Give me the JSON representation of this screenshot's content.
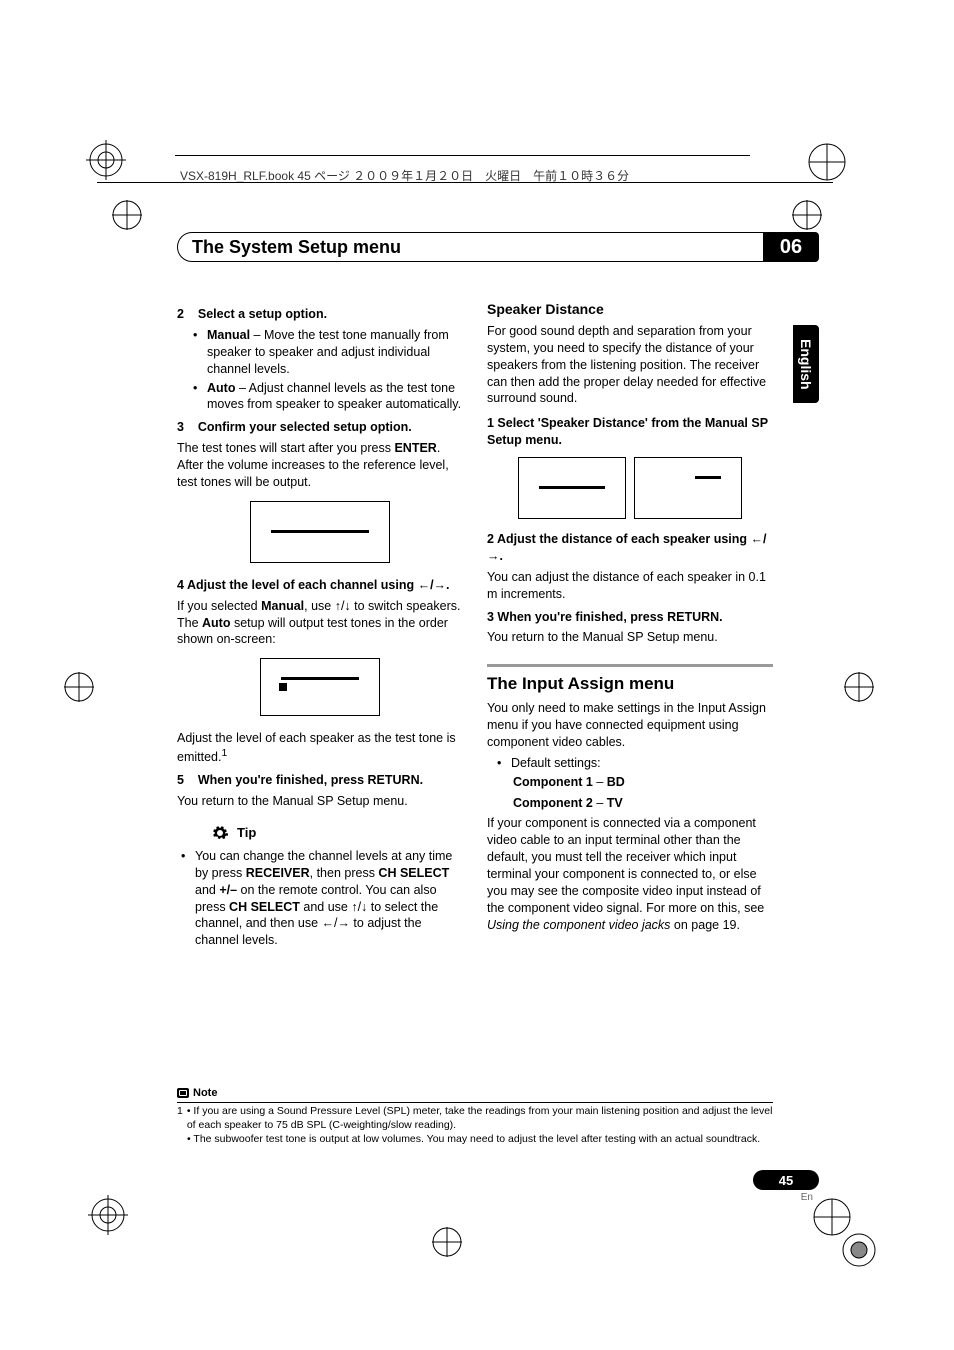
{
  "header_line": "VSX-819H_RLF.book  45 ページ  ２００９年１月２０日　火曜日　午前１０時３６分",
  "title": "The System Setup menu",
  "chapter": "06",
  "lang_tab": "English",
  "left": {
    "s2": {
      "num": "2",
      "head": "Select a setup option."
    },
    "b_manual_label": "Manual",
    "b_manual_text": " – Move the test tone manually from speaker to speaker and adjust individual channel levels.",
    "b_auto_label": "Auto",
    "b_auto_text": " – Adjust channel levels as the test tone moves from speaker to speaker automatically.",
    "s3": {
      "num": "3",
      "head": "Confirm your selected setup option."
    },
    "s3_p1a": "The test tones will start after you press ",
    "s3_p1b": "ENTER",
    "s3_p1c": ". After the volume increases to the reference level, test tones will be output.",
    "s4_head": "4    Adjust the level of each channel using ←/→.",
    "s4_p1a": "If you selected ",
    "s4_p1b": "Manual",
    "s4_p1c": ", use ↑/↓ to switch speakers. The ",
    "s4_p1d": "Auto",
    "s4_p1e": " setup will output test tones in the order shown on-screen:",
    "s4_p2": "Adjust the level of each speaker as the test tone is emitted.",
    "sup1": "1",
    "s5": {
      "num": "5",
      "head": "When you're finished, press RETURN."
    },
    "s5_p": "You return to the Manual SP Setup menu.",
    "tip_label": "Tip",
    "tip_a": "You can change the channel levels at any time by press ",
    "tip_b": "RECEIVER",
    "tip_c": ", then press ",
    "tip_d": "CH SELECT",
    "tip_e": " and ",
    "tip_f": "+/–",
    "tip_g": " on the remote control. You can also press ",
    "tip_h": "CH SELECT",
    "tip_i": " and use ↑/↓ to select the channel, and then use ←/→ to adjust the channel levels."
  },
  "right": {
    "h_speaker": "Speaker Distance",
    "sp_p": "For good sound depth and separation from your system, you need to specify the distance of your speakers from the listening position. The receiver can then add the proper delay needed for effective surround sound.",
    "sp_s1": "1    Select 'Speaker Distance' from the Manual SP Setup menu.",
    "sp_s2": "2    Adjust the distance of each speaker using ←/→.",
    "sp_s2_p": "You can adjust the distance of each speaker in 0.1 m increments.",
    "sp_s3": "3    When you're finished, press RETURN.",
    "sp_s3_p": "You return to the Manual SP Setup menu.",
    "h_input": "The Input Assign menu",
    "in_p1": "You only need to make settings in the Input Assign menu if you have connected equipment using component video cables.",
    "in_def": "Default settings:",
    "in_c1a": "Component 1",
    "in_c1b": " – ",
    "in_c1c": "BD",
    "in_c2a": "Component 2",
    "in_c2b": " – ",
    "in_c2c": "TV",
    "in_p2a": "If your component is connected via a component video cable to an input terminal other than the default, you must tell the receiver which input terminal your component is connected to, or else you may see the composite video input instead of the component video signal. For more on this, see ",
    "in_p2b": "Using the component video jacks",
    "in_p2c": " on page 19."
  },
  "note": {
    "label": "Note",
    "n1": "• If you are using a Sound Pressure Level (SPL) meter, take the readings from your main listening position and adjust the level of each speaker to 75 dB SPL (C-weighting/slow reading).",
    "n2": "• The subwoofer test tone is output at low volumes. You may need to adjust the level after testing with an actual soundtrack."
  },
  "page_num": "45",
  "page_lang": "En"
}
